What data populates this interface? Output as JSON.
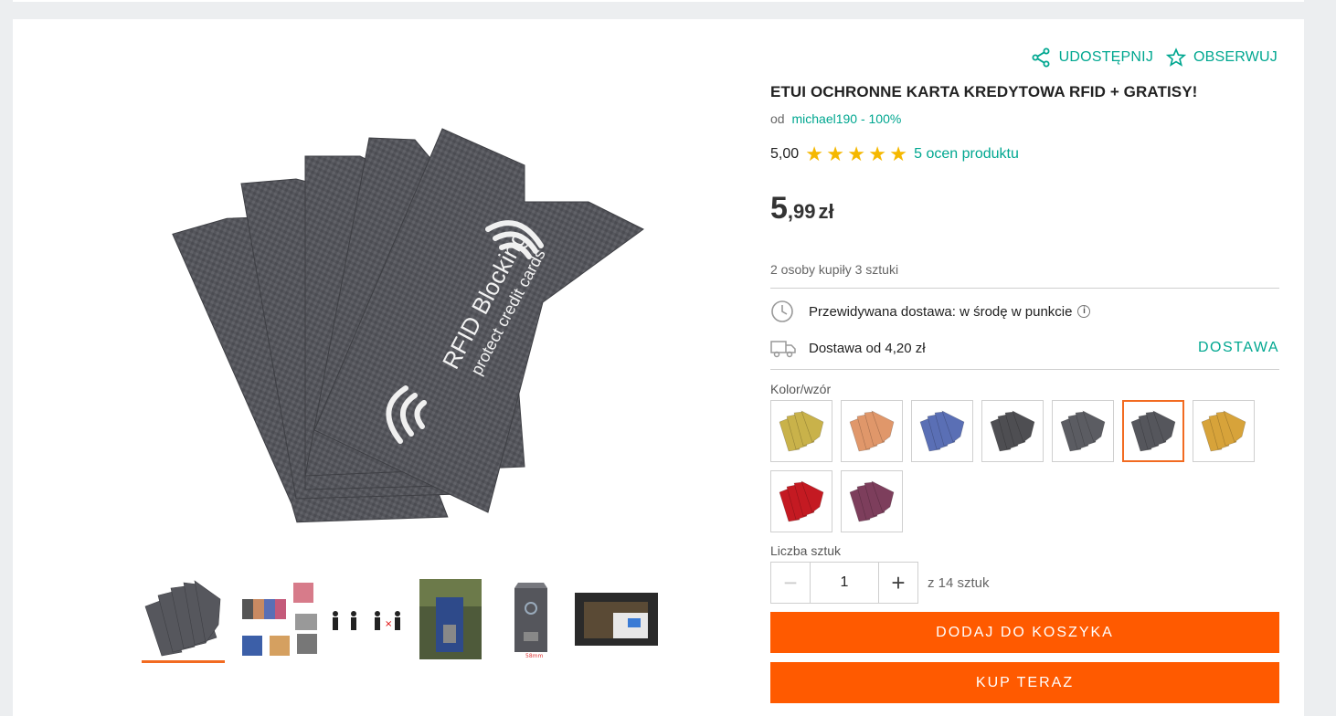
{
  "share_label": "UDOSTĘPNIJ",
  "watch_label": "OBSERWUJ",
  "product_title": "ETUI OCHRONNE KARTA KREDYTOWA RFID + GRATISY!",
  "seller_prefix": "od",
  "seller_name": "michael190 - 100%",
  "rating_value": "5,00",
  "rating_stars": 5,
  "rating_link": "5 ocen produktu",
  "price_int": "5",
  "price_frac": ",99",
  "price_currency": "zł",
  "sold_text": "2 osoby kupiły 3 sztuki",
  "delivery_estimate": "Przewidywana dostawa: w środę w punkcie",
  "delivery_cost": "Dostawa od 4,20 zł",
  "delivery_link": "DOSTAWA",
  "color_label": "Kolor/wzór",
  "swatches": [
    {
      "name": "gold-carbon",
      "color": "#c9b24a"
    },
    {
      "name": "rose-gold",
      "color": "#e0976a"
    },
    {
      "name": "blue",
      "color": "#5a6fb5"
    },
    {
      "name": "dark-grey",
      "color": "#4e4e52"
    },
    {
      "name": "grey-rfid",
      "color": "#5b5c62"
    },
    {
      "name": "carbon-grey",
      "color": "#55565c",
      "selected": true
    },
    {
      "name": "gold",
      "color": "#d7a33a"
    },
    {
      "name": "red",
      "color": "#c41a22"
    },
    {
      "name": "purple",
      "color": "#7d3e5c"
    }
  ],
  "quantity_label": "Liczba sztuk",
  "quantity_value": "1",
  "quantity_of": "z 14 sztuk",
  "add_to_cart": "DODAJ DO KOSZYKA",
  "buy_now": "KUP TERAZ",
  "main_image": {
    "text1": "RFID Blocking",
    "text2": "protect credit cards"
  },
  "thumbnail_count": 6,
  "colors": {
    "accent": "#00a790",
    "orange": "#ff5a00",
    "active": "#f26b21",
    "star": "#f5b800"
  }
}
